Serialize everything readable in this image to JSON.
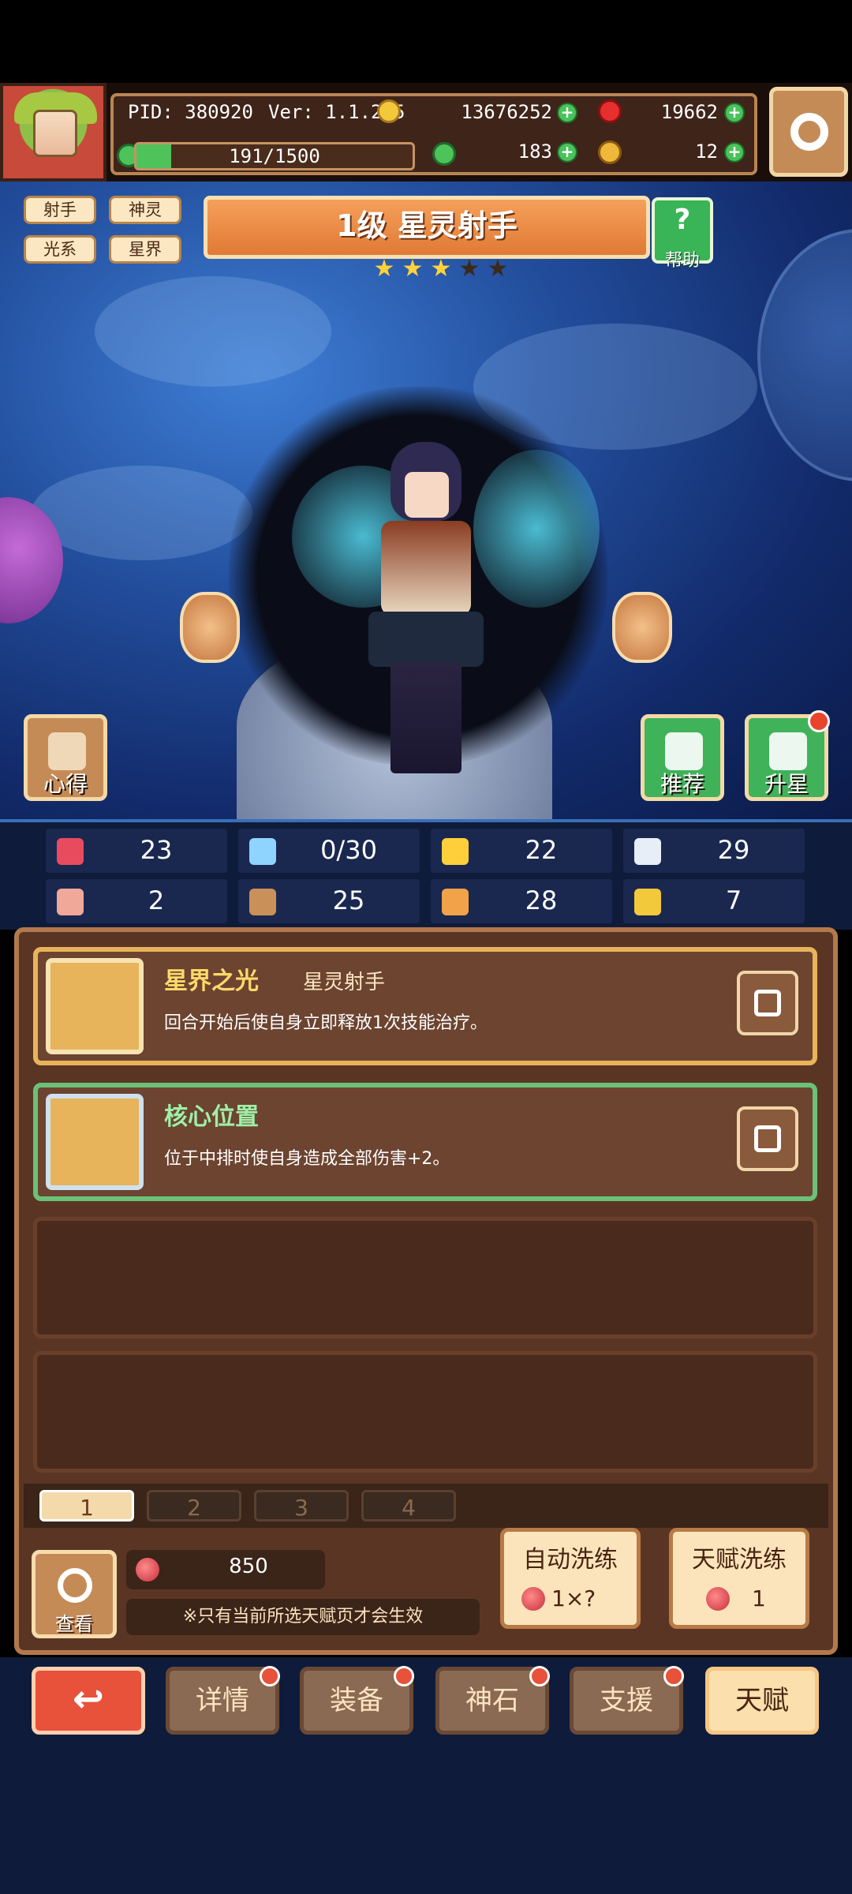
{
  "header": {
    "pid": "PID: 380920",
    "version": "Ver: 1.1.2.5",
    "gold": "13676252",
    "gems": "19662",
    "energy": "191/1500",
    "energy_fraction": 0.127,
    "green_currency": "183",
    "key_currency": "12"
  },
  "hero": {
    "tags": [
      "射手",
      "神灵",
      "光系",
      "星界"
    ],
    "title": "1级 星灵射手",
    "stars_filled": 3,
    "stars_total": 5,
    "help_label": "帮助",
    "left_button_label": "心得",
    "recommend_label": "推荐",
    "star_up_label": "升星"
  },
  "stats": [
    {
      "icon": "heart-icon",
      "value": "23",
      "color": "#e94b5e"
    },
    {
      "icon": "water-drop-icon",
      "value": "0/30",
      "color": "#8fd3ff"
    },
    {
      "icon": "shield-icon",
      "value": "22",
      "color": "#ffcf3b"
    },
    {
      "icon": "wing-icon",
      "value": "29",
      "color": "#e8eef8"
    },
    {
      "icon": "fist-icon",
      "value": "2",
      "color": "#f0a899"
    },
    {
      "icon": "book-icon",
      "value": "25",
      "color": "#c9905a"
    },
    {
      "icon": "boot-icon",
      "value": "28",
      "color": "#f2a34a"
    },
    {
      "icon": "horseshoe-icon",
      "value": "7",
      "color": "#f2c93b"
    }
  ],
  "talents": [
    {
      "name": "星界之光",
      "subtitle": "星灵射手",
      "description": "回合开始后使自身立即释放1次技能治疗。"
    },
    {
      "name": "核心位置",
      "subtitle": "",
      "description": "位于中排时使自身造成全部伤害+2。"
    }
  ],
  "pages": [
    "1",
    "2",
    "3",
    "4"
  ],
  "footer": {
    "view_label": "查看",
    "fruit_count": "850",
    "notice": "※只有当前所选天赋页才会生效",
    "auto_wash_label": "自动洗练",
    "auto_wash_cost": "1×?",
    "talent_wash_label": "天赋洗练",
    "talent_wash_cost": "1"
  },
  "nav": {
    "back": "↩",
    "details": "详情",
    "equipment": "装备",
    "stone": "神石",
    "support": "支援",
    "talent": "天赋"
  }
}
